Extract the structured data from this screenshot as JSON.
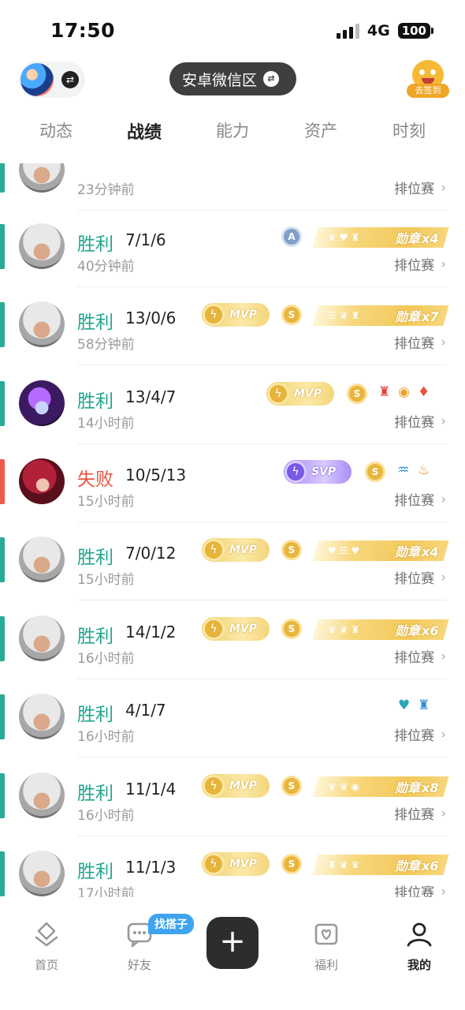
{
  "status_bar": {
    "time": "17:50",
    "network": "4G",
    "battery": "100"
  },
  "header": {
    "server_label": "安卓微信区",
    "checkin_label": "去签到",
    "icons": {
      "swap": "swap-icon",
      "checkin": "checkin-mascot-icon"
    }
  },
  "tabs": [
    {
      "label": "动态",
      "active": false
    },
    {
      "label": "战绩",
      "active": true
    },
    {
      "label": "能力",
      "active": false
    },
    {
      "label": "资产",
      "active": false
    },
    {
      "label": "时刻",
      "active": false
    }
  ],
  "matches": [
    {
      "result": "",
      "kda": "",
      "time": "23分钟前",
      "mode": "排位赛",
      "outcome": "win",
      "hero": "silver"
    },
    {
      "result": "胜利",
      "kda": "7/1/6",
      "time": "40分钟前",
      "mode": "排位赛",
      "outcome": "win",
      "hero": "silver",
      "medal": {
        "label": "勋章",
        "count": "x4"
      }
    },
    {
      "result": "胜利",
      "kda": "13/0/6",
      "time": "58分钟前",
      "mode": "排位赛",
      "outcome": "win",
      "hero": "silver",
      "badge": "MVP",
      "medal": {
        "label": "勋章",
        "count": "x7"
      }
    },
    {
      "result": "胜利",
      "kda": "13/4/7",
      "time": "14小时前",
      "mode": "排位赛",
      "outcome": "win",
      "hero": "purple",
      "badge": "MVP"
    },
    {
      "result": "失败",
      "kda": "10/5/13",
      "time": "15小时前",
      "mode": "排位赛",
      "outcome": "loss",
      "hero": "red",
      "badge": "SVP"
    },
    {
      "result": "胜利",
      "kda": "7/0/12",
      "time": "15小时前",
      "mode": "排位赛",
      "outcome": "win",
      "hero": "silver",
      "badge": "MVP",
      "medal": {
        "label": "勋章",
        "count": "x4"
      }
    },
    {
      "result": "胜利",
      "kda": "14/1/2",
      "time": "16小时前",
      "mode": "排位赛",
      "outcome": "win",
      "hero": "silver",
      "badge": "MVP",
      "medal": {
        "label": "勋章",
        "count": "x6"
      }
    },
    {
      "result": "胜利",
      "kda": "4/1/7",
      "time": "16小时前",
      "mode": "排位赛",
      "outcome": "win",
      "hero": "silver"
    },
    {
      "result": "胜利",
      "kda": "11/1/4",
      "time": "16小时前",
      "mode": "排位赛",
      "outcome": "win",
      "hero": "silver",
      "badge": "MVP",
      "medal": {
        "label": "勋章",
        "count": "x8"
      }
    },
    {
      "result": "胜利",
      "kda": "11/1/3",
      "time": "17小时前",
      "mode": "排位赛",
      "outcome": "win",
      "hero": "silver",
      "badge": "MVP",
      "medal": {
        "label": "勋章",
        "count": "x6"
      }
    }
  ],
  "badge_icons": {
    "mvp_orb": "lightning-icon",
    "coin": "s-coin-icon",
    "rank": "a-rank-icon"
  },
  "coin_letter": "S",
  "rank_letter": "A",
  "bottom_nav": {
    "home": "首页",
    "friends": "好友",
    "friends_tag": "找搭子",
    "welfare": "福利",
    "mine": "我的"
  },
  "colors": {
    "win": "#21a690",
    "loss": "#e8523f",
    "accent": "#2aab96"
  }
}
